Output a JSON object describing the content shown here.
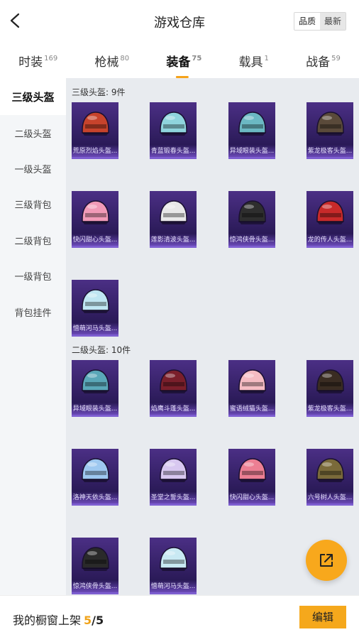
{
  "header": {
    "title": "游戏仓库",
    "sort_options": [
      "品质",
      "最新"
    ],
    "sort_selected": "品质"
  },
  "tabs": [
    {
      "label": "时装",
      "count": "169"
    },
    {
      "label": "枪械",
      "count": "80"
    },
    {
      "label": "装备",
      "count": "75"
    },
    {
      "label": "载具",
      "count": "1"
    },
    {
      "label": "战备",
      "count": "59"
    }
  ],
  "active_tab": "装备",
  "sidebar": {
    "items": [
      "三级头盔",
      "二级头盔",
      "一级头盔",
      "三级背包",
      "二级背包",
      "一级背包",
      "背包挂件"
    ],
    "active": "三级头盔"
  },
  "groups": [
    {
      "title": "三级头盔: 9件",
      "items": [
        {
          "name": "荒原烈焰头盔...",
          "color": "#c7432c"
        },
        {
          "name": "青蓝锻春头盔...",
          "color": "#8fd4dd"
        },
        {
          "name": "异域眼装头盔...",
          "color": "#6bb8c3"
        },
        {
          "name": "紫龙极客头盔...",
          "color": "#5a4a3a"
        },
        {
          "name": "快闪甜心头盔...",
          "color": "#f19ab7"
        },
        {
          "name": "莲影清波头盔...",
          "color": "#e8e8e8"
        },
        {
          "name": "惊鸿侠骨头盔...",
          "color": "#2e2e2e"
        },
        {
          "name": "龙的传人头盔...",
          "color": "#c82a2a"
        },
        {
          "name": "憎萌河马头盔...",
          "color": "#bfe6f2"
        }
      ]
    },
    {
      "title": "二级头盔: 10件",
      "items": [
        {
          "name": "异域眼装头盔...",
          "color": "#5aa7b8"
        },
        {
          "name": "焰鹰斗蓬头盔...",
          "color": "#7a1f2b"
        },
        {
          "name": "蜜语绒猫头盔...",
          "color": "#f5bcc3"
        },
        {
          "name": "紫龙极客头盔...",
          "color": "#3a2c22"
        },
        {
          "name": "洛神天依头盔...",
          "color": "#9ec8f0"
        },
        {
          "name": "圣堂之誓头盔...",
          "color": "#d8c8f0"
        },
        {
          "name": "快闪甜心头盔...",
          "color": "#ec7f93"
        },
        {
          "name": "六号树人头盔...",
          "color": "#7a6a3a"
        },
        {
          "name": "惊鸿侠骨头盔...",
          "color": "#2a2a2a"
        },
        {
          "name": "憎萌河马头盔...",
          "color": "#c9e9f3"
        }
      ]
    }
  ],
  "bottom": {
    "shelf_label": "我的橱窗上架",
    "shelf_current": "5",
    "shelf_total": "/5",
    "edit_label": "编辑"
  },
  "colors": {
    "accent": "#f5a81c",
    "card_bg": "#3a2570",
    "card_border": "#7d5ed0"
  }
}
